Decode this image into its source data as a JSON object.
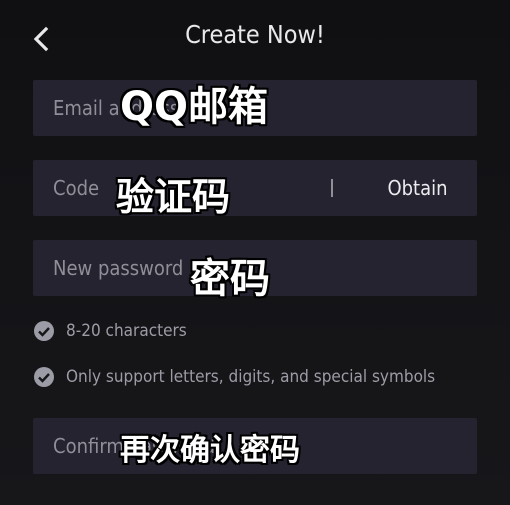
{
  "header": {
    "title": "Create Now!",
    "back_icon": "chevron-left-icon"
  },
  "form": {
    "email": {
      "placeholder": "Email address",
      "overlay_label": "QQ邮箱"
    },
    "code": {
      "placeholder": "Code",
      "overlay_label": "验证码",
      "obtain_label": "Obtain"
    },
    "password": {
      "placeholder": "New password",
      "overlay_label": "密码"
    },
    "confirm": {
      "placeholder": "Confirm password",
      "overlay_label": "再次确认密码"
    }
  },
  "rules": [
    {
      "icon": "check-circle-icon",
      "text": "8-20 characters"
    },
    {
      "icon": "check-circle-icon",
      "text": "Only support letters, digits, and special symbols"
    }
  ],
  "colors": {
    "background": "#131316",
    "field": "#24232f",
    "text": "#e9e9ec",
    "placeholder": "#8f8f98",
    "rule_text": "#9c9ca6"
  }
}
